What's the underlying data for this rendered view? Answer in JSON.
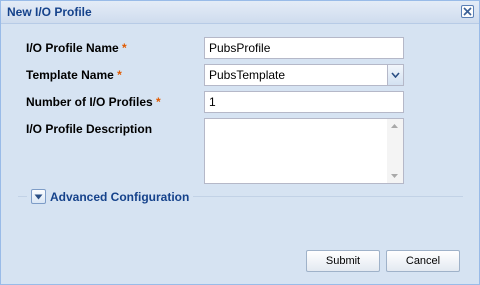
{
  "dialog": {
    "title": "New I/O Profile",
    "close_icon": "close-icon"
  },
  "form": {
    "profile_name": {
      "label": "I/O Profile Name",
      "required": "*",
      "value": "PubsProfile"
    },
    "template_name": {
      "label": "Template Name",
      "required": "*",
      "value": "PubsTemplate"
    },
    "num_profiles": {
      "label": "Number of I/O Profiles",
      "required": "*",
      "value": "1"
    },
    "description": {
      "label": "I/O Profile Description",
      "value": ""
    }
  },
  "advanced": {
    "label": "Advanced Configuration",
    "icon": "chevron-down-icon"
  },
  "buttons": {
    "submit": "Submit",
    "cancel": "Cancel"
  },
  "colors": {
    "accent_text": "#15428b",
    "required_marker": "#e05a00",
    "dialog_bg": "#d6e3f2"
  }
}
